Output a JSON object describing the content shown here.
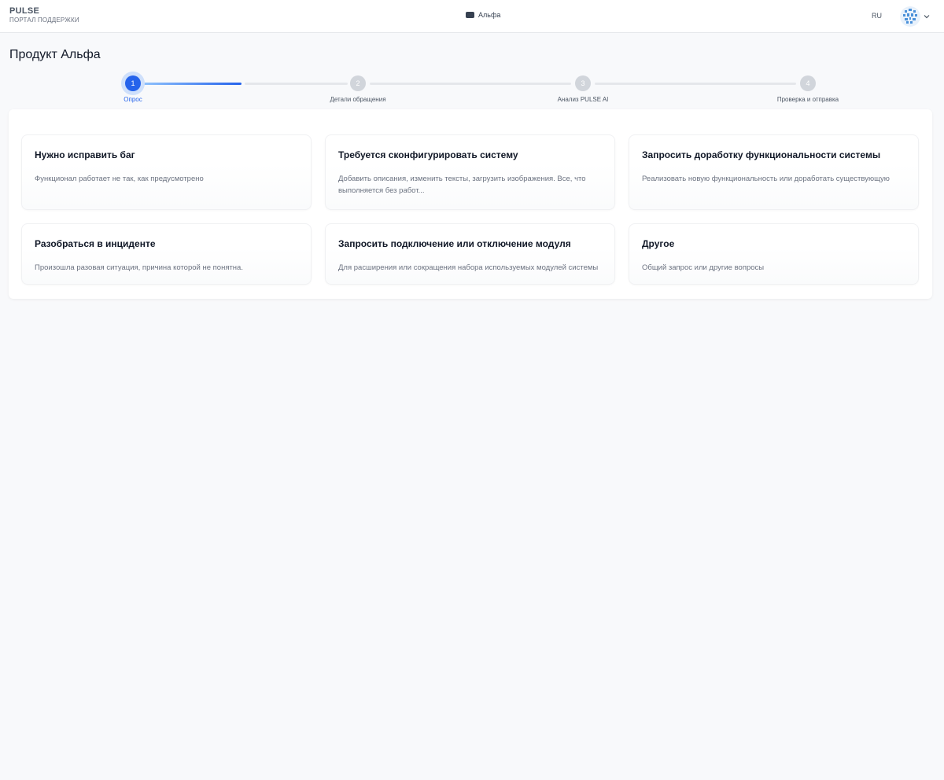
{
  "header": {
    "brand_title": "PULSE",
    "brand_subtitle": "ПОРТАЛ ПОДДЕРЖКИ",
    "product": "Альфа",
    "language": "RU"
  },
  "page": {
    "title": "Продукт Альфа"
  },
  "stepper": {
    "current_step": 1,
    "steps": [
      {
        "number": "1",
        "label": "Опрос"
      },
      {
        "number": "2",
        "label": "Детали обращения"
      },
      {
        "number": "3",
        "label": "Анализ PULSE AI"
      },
      {
        "number": "4",
        "label": "Проверка и отправка"
      }
    ]
  },
  "cards": [
    {
      "title": "Нужно исправить баг",
      "description": "Функционал работает не так, как предусмотрено"
    },
    {
      "title": "Требуется сконфигурировать систему",
      "description": "Добавить описания, изменить тексты, загрузить изображения. Все, что выполняется без работ..."
    },
    {
      "title": "Запросить доработку функциональности системы",
      "description": "Реализовать новую функциональность или доработать существующую"
    },
    {
      "title": "Разобраться в инциденте",
      "description": "Произошла разовая ситуация, причина которой не понятна."
    },
    {
      "title": "Запросить подключение или отключение модуля",
      "description": "Для расширения или сокращения набора используемых модулей системы"
    },
    {
      "title": "Другое",
      "description": "Общий запрос или другие вопросы"
    }
  ],
  "colors": {
    "accent": "#2563eb",
    "inactive_step": "#d1d5db",
    "background": "#f8f9fb"
  },
  "icons": {
    "product": "product-icon",
    "avatar": "avatar-icon",
    "dropdown": "chevron-down-icon"
  }
}
